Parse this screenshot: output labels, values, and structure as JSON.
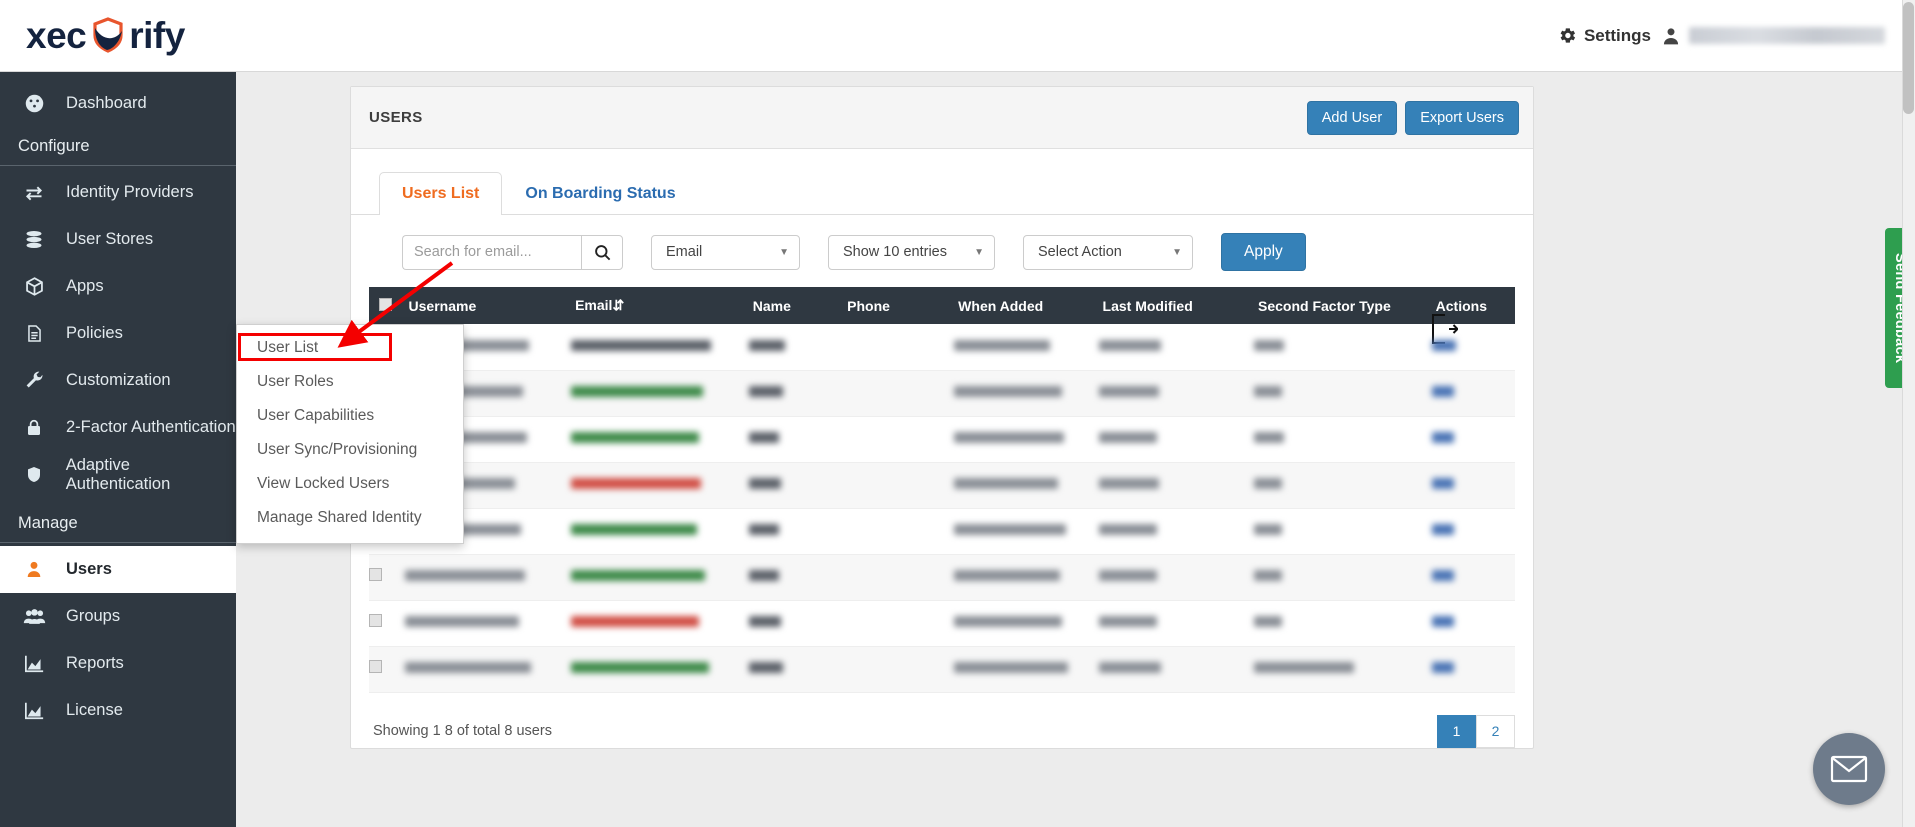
{
  "topbar": {
    "logo_left": "xec",
    "logo_right": "rify",
    "logo_icon": "shield-icon",
    "settings_label": "Settings",
    "settings_icon": "gear-icon",
    "account_icon": "user-icon",
    "account_name_redacted": ""
  },
  "sidebar": {
    "items": [
      {
        "label": "Dashboard",
        "icon": "speedometer-icon",
        "active": false
      },
      {
        "label": "Identity Providers",
        "icon": "exchange-arrows-icon",
        "active": false
      },
      {
        "label": "User Stores",
        "icon": "database-icon",
        "active": false
      },
      {
        "label": "Apps",
        "icon": "cube-icon",
        "active": false
      },
      {
        "label": "Policies",
        "icon": "document-icon",
        "active": false
      },
      {
        "label": "Customization",
        "icon": "wrench-icon",
        "active": false
      },
      {
        "label": "2-Factor Authentication",
        "icon": "lock-icon",
        "active": false
      },
      {
        "label": "Adaptive Authentication",
        "icon": "shield-icon",
        "active": false
      },
      {
        "label": "Users",
        "icon": "user-icon",
        "active": true
      },
      {
        "label": "Groups",
        "icon": "users-group-icon",
        "active": false
      },
      {
        "label": "Reports",
        "icon": "chart-icon",
        "active": false
      },
      {
        "label": "License",
        "icon": "chart-icon",
        "active": false
      }
    ],
    "sections": {
      "configure": "Configure",
      "manage": "Manage"
    }
  },
  "dropdown": {
    "items": [
      "User List",
      "User Roles",
      "User Capabilities",
      "User Sync/Provisioning",
      "View Locked Users",
      "Manage Shared Identity"
    ],
    "highlighted": "User List",
    "highlight_color": "#f40000"
  },
  "card": {
    "title": "USERS",
    "add_user_label": "Add User",
    "export_users_label": "Export Users",
    "tabs": [
      {
        "label": "Users List",
        "active": true
      },
      {
        "label": "On Boarding Status",
        "active": false
      }
    ]
  },
  "toolbar": {
    "search_placeholder": "Search for email...",
    "search_value": "",
    "search_icon": "search-icon",
    "filter_field": "Email",
    "entries_select": "Show 10 entries",
    "action_select": "Select Action",
    "apply_label": "Apply",
    "export_icon": "export-file-icon"
  },
  "table": {
    "columns": [
      "Username",
      "Email",
      "Name",
      "Phone",
      "When Added",
      "Last Modified",
      "Second Factor Type",
      "Actions"
    ],
    "sort_column": "Email",
    "sort_icon": "sort-icon",
    "select_all_icon": "checkbox-icon",
    "row_count": 8
  },
  "footer": {
    "showing_text": "Showing 1  8 of total 8 users",
    "pages": [
      "1",
      "2"
    ],
    "current_page": "1"
  },
  "widgets": {
    "feedback_label": "Send Feedback",
    "feedback_color": "#2e9e4f",
    "mail_icon": "envelope-icon"
  },
  "colors": {
    "sidebar_bg": "#2f3841",
    "accent_orange": "#ef6c20",
    "accent_blue": "#3581b8",
    "table_header": "#2f3841"
  }
}
